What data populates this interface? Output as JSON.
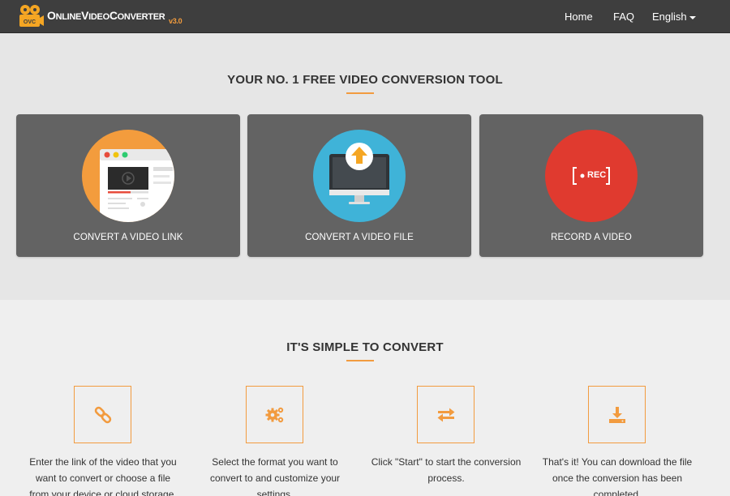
{
  "header": {
    "brand_online": "Online",
    "brand_video": "Video",
    "brand_converter": "Converter",
    "version": "v3.0",
    "nav": {
      "home": "Home",
      "faq": "FAQ",
      "language": "English"
    }
  },
  "hero": {
    "title": "YOUR NO. 1 FREE VIDEO CONVERSION TOOL",
    "cards": [
      {
        "label": "CONVERT A VIDEO LINK",
        "icon": "browser-video-icon",
        "color": "#f39c3d"
      },
      {
        "label": "CONVERT A VIDEO FILE",
        "icon": "monitor-upload-icon",
        "color": "#3fb3d8"
      },
      {
        "label": "RECORD A VIDEO",
        "icon": "rec-icon",
        "rec_text": "REC",
        "color": "#e03a2f"
      }
    ]
  },
  "steps": {
    "title": "IT'S SIMPLE TO CONVERT",
    "items": [
      {
        "icon": "link-icon",
        "text_lines": [
          "Enter the link of the video that you",
          "want to convert or choose a file",
          "from your device or cloud storage."
        ]
      },
      {
        "icon": "gears-icon",
        "text_lines": [
          "Select the format you want to",
          "convert to and customize your",
          "settings."
        ]
      },
      {
        "icon": "exchange-icon",
        "text_lines": [
          "Click \"Start\" to start the conversion",
          "process."
        ]
      },
      {
        "icon": "download-icon",
        "text_lines": [
          "That's it! You can download the file",
          "once the conversion has been",
          "completed."
        ]
      }
    ]
  },
  "colors": {
    "accent": "#f29b3f",
    "navbar": "#3e3e3e",
    "card": "#636363"
  }
}
